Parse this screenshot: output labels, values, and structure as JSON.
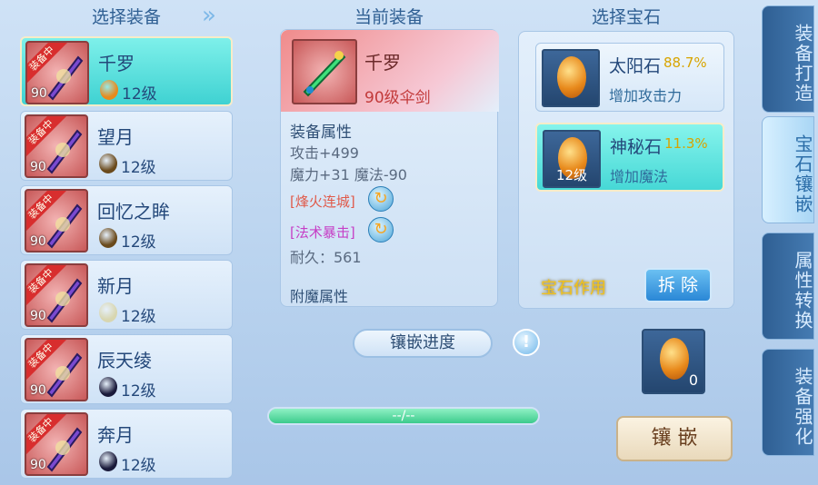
{
  "sections": {
    "select_equipment": "选择装备",
    "current_equipment": "当前装备",
    "select_gem": "选择宝石"
  },
  "equipment_list": [
    {
      "name": "千罗",
      "level": "90",
      "badge": "装备中",
      "gem_level": "12级",
      "gem_color": "#e88a1c",
      "selected": true
    },
    {
      "name": "望月",
      "level": "90",
      "badge": "装备中",
      "gem_level": "12级",
      "gem_color": "#6a4a1c",
      "selected": false
    },
    {
      "name": "回忆之眸",
      "level": "90",
      "badge": "装备中",
      "gem_level": "12级",
      "gem_color": "#6a4a1c",
      "selected": false
    },
    {
      "name": "新月",
      "level": "90",
      "badge": "装备中",
      "gem_level": "12级",
      "gem_color": "#d8d6b0",
      "selected": false
    },
    {
      "name": "辰天绫",
      "level": "90",
      "badge": "装备中",
      "gem_level": "12级",
      "gem_color": "#1a1a3a",
      "selected": false
    },
    {
      "name": "奔月",
      "level": "90",
      "badge": "装备中",
      "gem_level": "12级",
      "gem_color": "#1a1a3a",
      "selected": false
    }
  ],
  "current": {
    "name": "千罗",
    "type": "90级伞剑",
    "attr_title": "装备属性",
    "attack": "攻击+499",
    "magic": "魔力+31 魔法-90",
    "skill1": "[烽火连城]",
    "skill2": "[法术暴击]",
    "durability": "耐久：561",
    "enchant": "附魔属性"
  },
  "gems": [
    {
      "name": "太阳石",
      "rate": "88.7%",
      "desc": "增加攻击力",
      "level": "",
      "selected": false
    },
    {
      "name": "神秘石",
      "rate": "11.3%",
      "desc": "增加魔法",
      "level": "12级",
      "selected": true
    }
  ],
  "gem_effect": "宝石作用",
  "remove_button": "拆 除",
  "inlay_progress": "镶嵌进度",
  "info_icon": "!",
  "progress_text": "--/--",
  "progress_value": 1.0,
  "gem_count": "0",
  "inlay_button": "镶 嵌",
  "side_tabs": [
    {
      "label": "装备打造",
      "active": false
    },
    {
      "label": "宝石镶嵌",
      "active": true
    },
    {
      "label": "属性转换",
      "active": false
    },
    {
      "label": "装备强化",
      "active": false
    }
  ]
}
